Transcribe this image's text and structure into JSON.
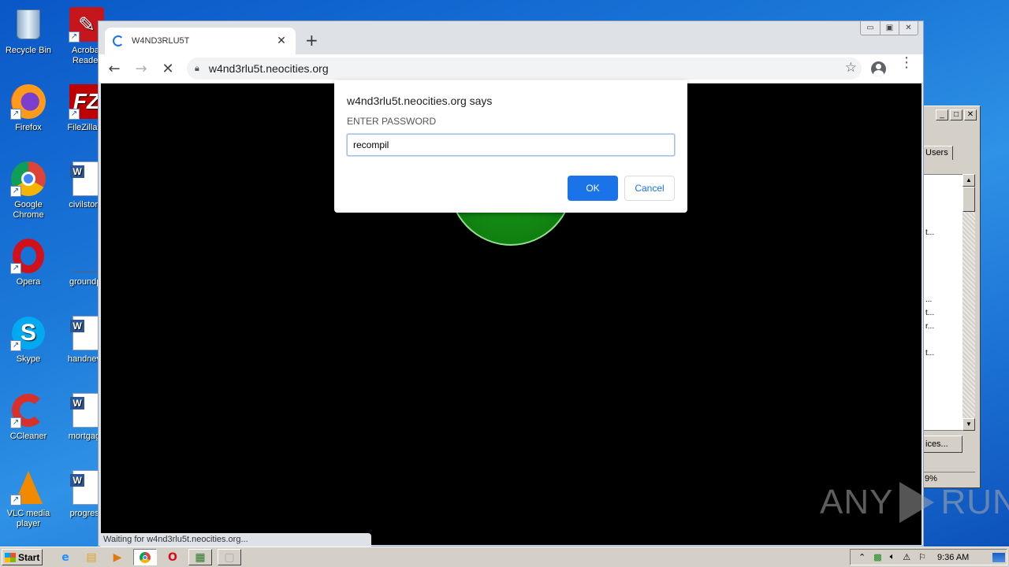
{
  "desktop": {
    "icons": [
      {
        "label": "Recycle Bin",
        "icon": "recycle-bin-icon"
      },
      {
        "label": "Acrobat Reader",
        "icon": "acrobat-icon"
      },
      {
        "label": "Firefox",
        "icon": "firefox-icon"
      },
      {
        "label": "FileZilla C",
        "icon": "filezilla-icon"
      },
      {
        "label": "Google Chrome",
        "icon": "chrome-icon"
      },
      {
        "label": "civilstorie",
        "icon": "word-doc-icon"
      },
      {
        "label": "Opera",
        "icon": "opera-icon"
      },
      {
        "label": "groundpr",
        "icon": "file-icon"
      },
      {
        "label": "Skype",
        "icon": "skype-icon"
      },
      {
        "label": "handneve",
        "icon": "word-doc-icon"
      },
      {
        "label": "CCleaner",
        "icon": "ccleaner-icon"
      },
      {
        "label": "mortgage",
        "icon": "word-doc-icon"
      },
      {
        "label": "VLC media player",
        "icon": "vlc-icon"
      },
      {
        "label": "progress",
        "icon": "word-doc-icon"
      }
    ]
  },
  "browser": {
    "tab_title": "W4ND3RLU5T",
    "url": "w4nd3rlu5t.neocities.org",
    "status_text": "Waiting for w4nd3rlu5t.neocities.org...",
    "window_controls": {
      "minimize": "▭",
      "restore": "▣",
      "close": "✕"
    }
  },
  "dialog": {
    "title": "w4nd3rlu5t.neocities.org says",
    "message": "ENTER PASSWORD",
    "input_value": "recompil",
    "ok_label": "OK",
    "cancel_label": "Cancel"
  },
  "background_window": {
    "tab_label": "Users",
    "rows": [
      "",
      "",
      "",
      "",
      "t...",
      "",
      "",
      "",
      "",
      "...",
      "t...",
      "r...",
      "",
      "t..."
    ],
    "button_label": "ices...",
    "status": "9%"
  },
  "watermark": {
    "left": "ANY",
    "right": "RUN"
  },
  "taskbar": {
    "start_label": "Start",
    "clock": "9:36 AM"
  },
  "colors": {
    "accent": "#1a73e8",
    "emblem_green": "#108010"
  }
}
